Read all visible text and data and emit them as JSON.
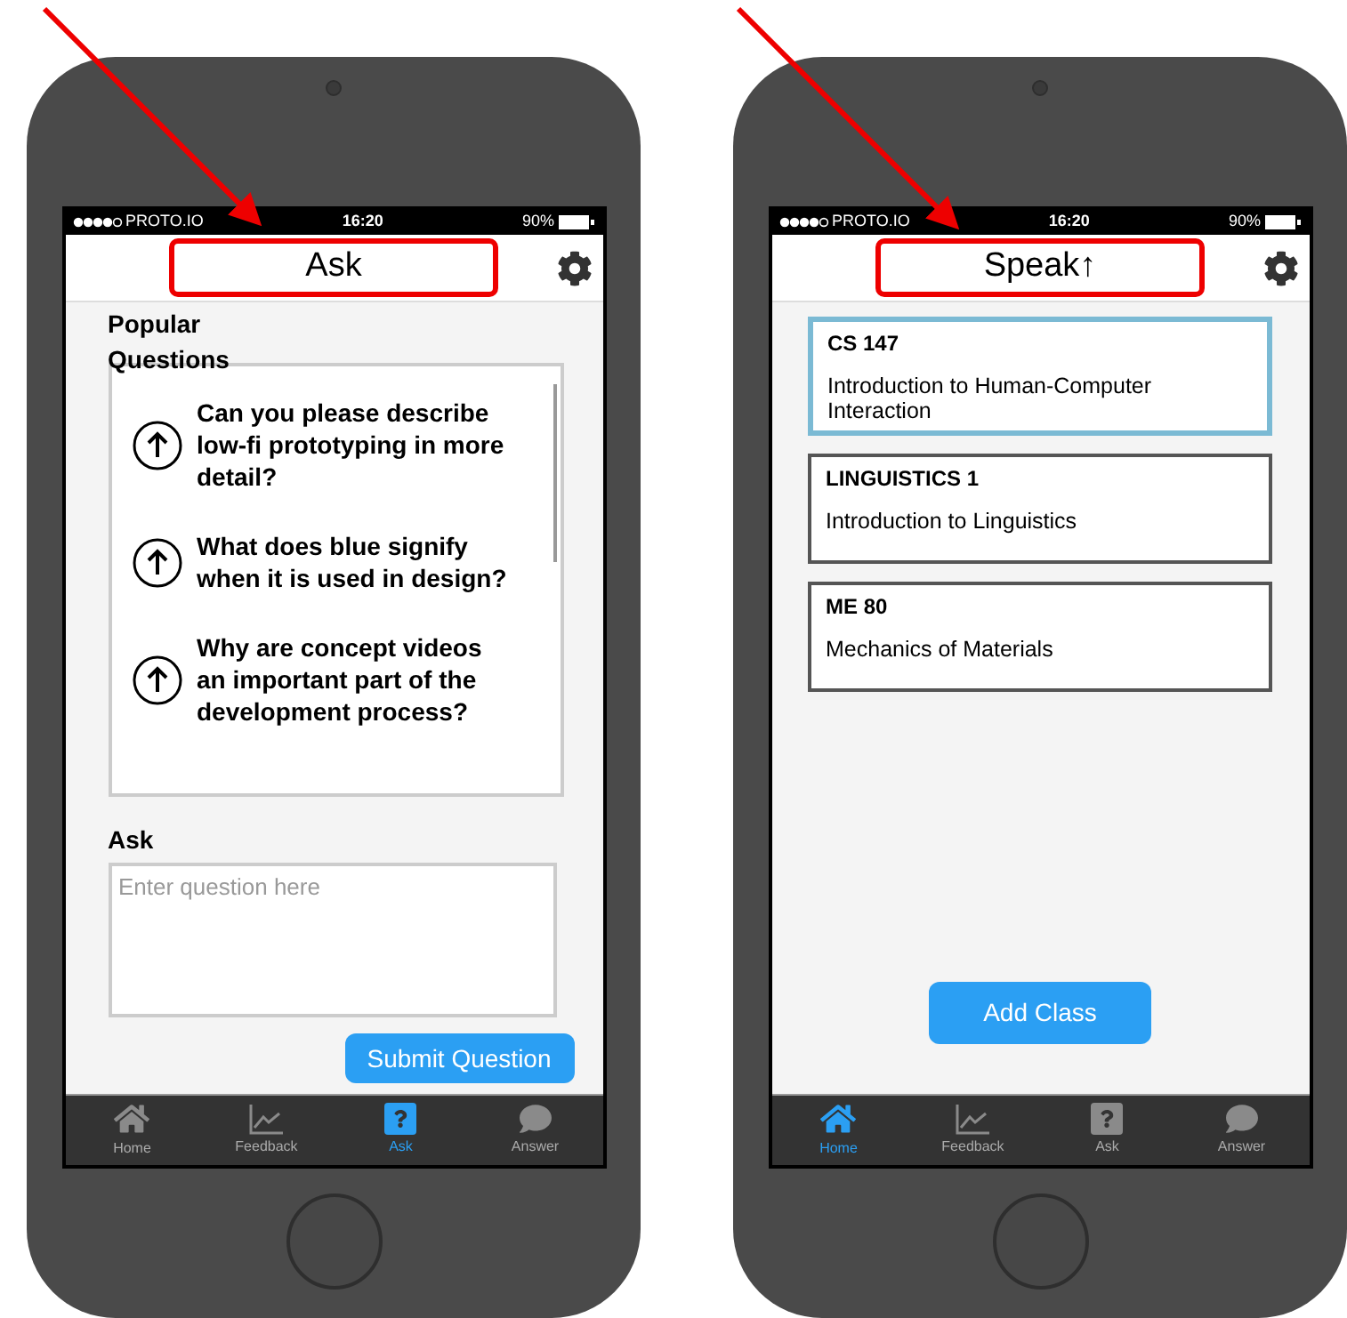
{
  "phones": [
    {
      "kind": "ask",
      "status_bar": {
        "carrier": "PROTO.IO",
        "time": "16:20",
        "battery": "90%"
      },
      "title": {
        "text": "Ask",
        "highlighted": true
      },
      "heading": "Popular Questions",
      "questions": [
        "Can you please describe low-fi prototyping in more detail?",
        "What does blue signify when it is used in design?",
        "Why are concept videos an important part of the development process?"
      ],
      "ask_label": "Ask",
      "question_field": {
        "placeholder": "Enter question here"
      },
      "submit_button": "Submit Question",
      "tabs": [
        {
          "label": "Home",
          "kind": "home",
          "selected": false
        },
        {
          "label": "Feedback",
          "kind": "chart",
          "selected": false
        },
        {
          "label": "Ask",
          "kind": "question",
          "selected": true
        },
        {
          "label": "Answer",
          "kind": "speech",
          "selected": false
        }
      ]
    },
    {
      "kind": "classes",
      "status_bar": {
        "carrier": "PROTO.IO",
        "time": "16:20",
        "battery": "90%"
      },
      "title": {
        "text": "Speak↑",
        "highlighted": true
      },
      "classes": [
        {
          "code": "CS 147",
          "name": "Introduction to Human-Computer Interaction",
          "selected": true
        },
        {
          "code": "LINGUISTICS 1",
          "name": "Introduction to Linguistics",
          "selected": false
        },
        {
          "code": "ME 80",
          "name": "Mechanics of Materials",
          "selected": false
        }
      ],
      "add_button": "Add Class",
      "tabs": [
        {
          "label": "Home",
          "kind": "home",
          "selected": true
        },
        {
          "label": "Feedback",
          "kind": "chart",
          "selected": false
        },
        {
          "label": "Ask",
          "kind": "question",
          "selected": false
        },
        {
          "label": "Answer",
          "kind": "speech",
          "selected": false
        }
      ]
    }
  ]
}
